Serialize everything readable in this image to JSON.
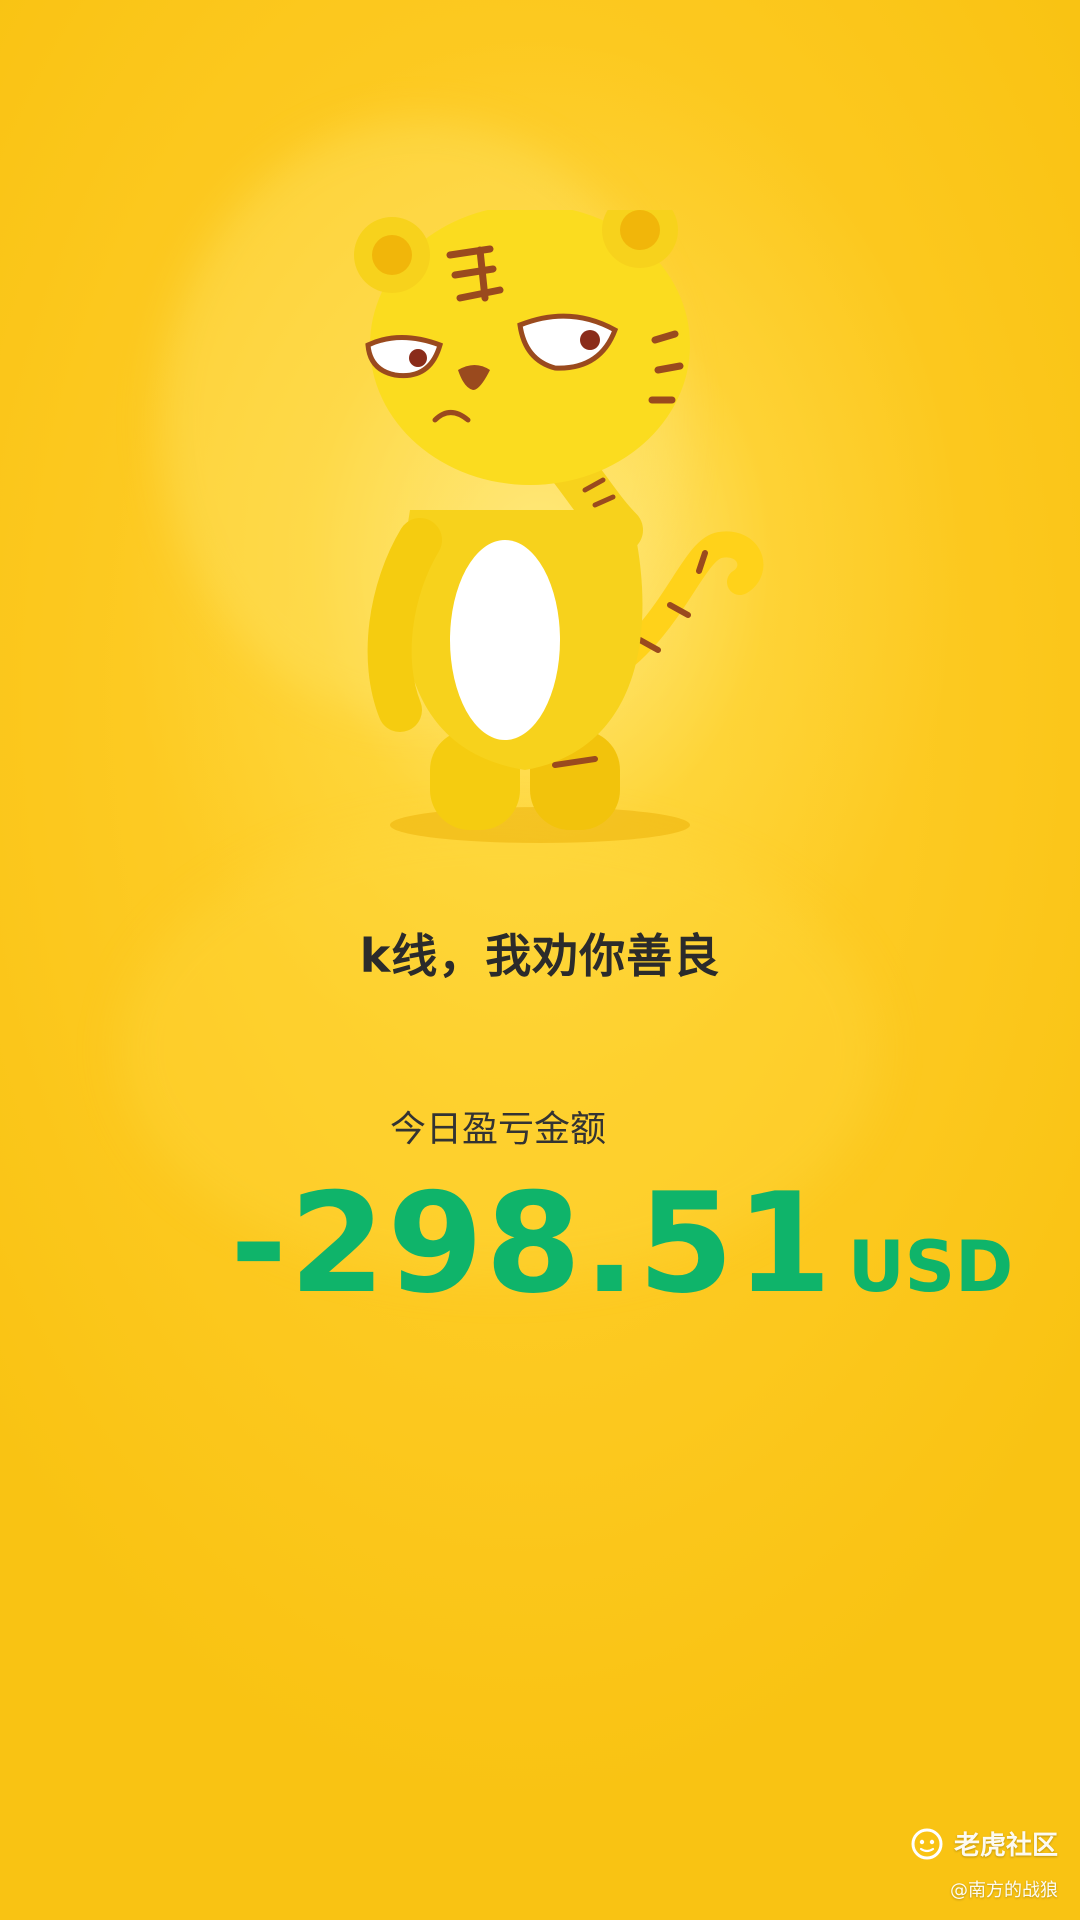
{
  "slogan": "k线，我劝你善良",
  "pnl": {
    "label": "今日盈亏金额",
    "value": "-298.51",
    "unit": "USD",
    "color": "#0fb46a"
  },
  "watermark": {
    "brand": "老虎社区",
    "author": "@南方的战狼",
    "icon": "tiger-logo-icon"
  },
  "mascot": {
    "icon": "tiger-mascot-icon"
  },
  "colors": {
    "background": "#fcc419",
    "text": "#2b2b2b"
  }
}
